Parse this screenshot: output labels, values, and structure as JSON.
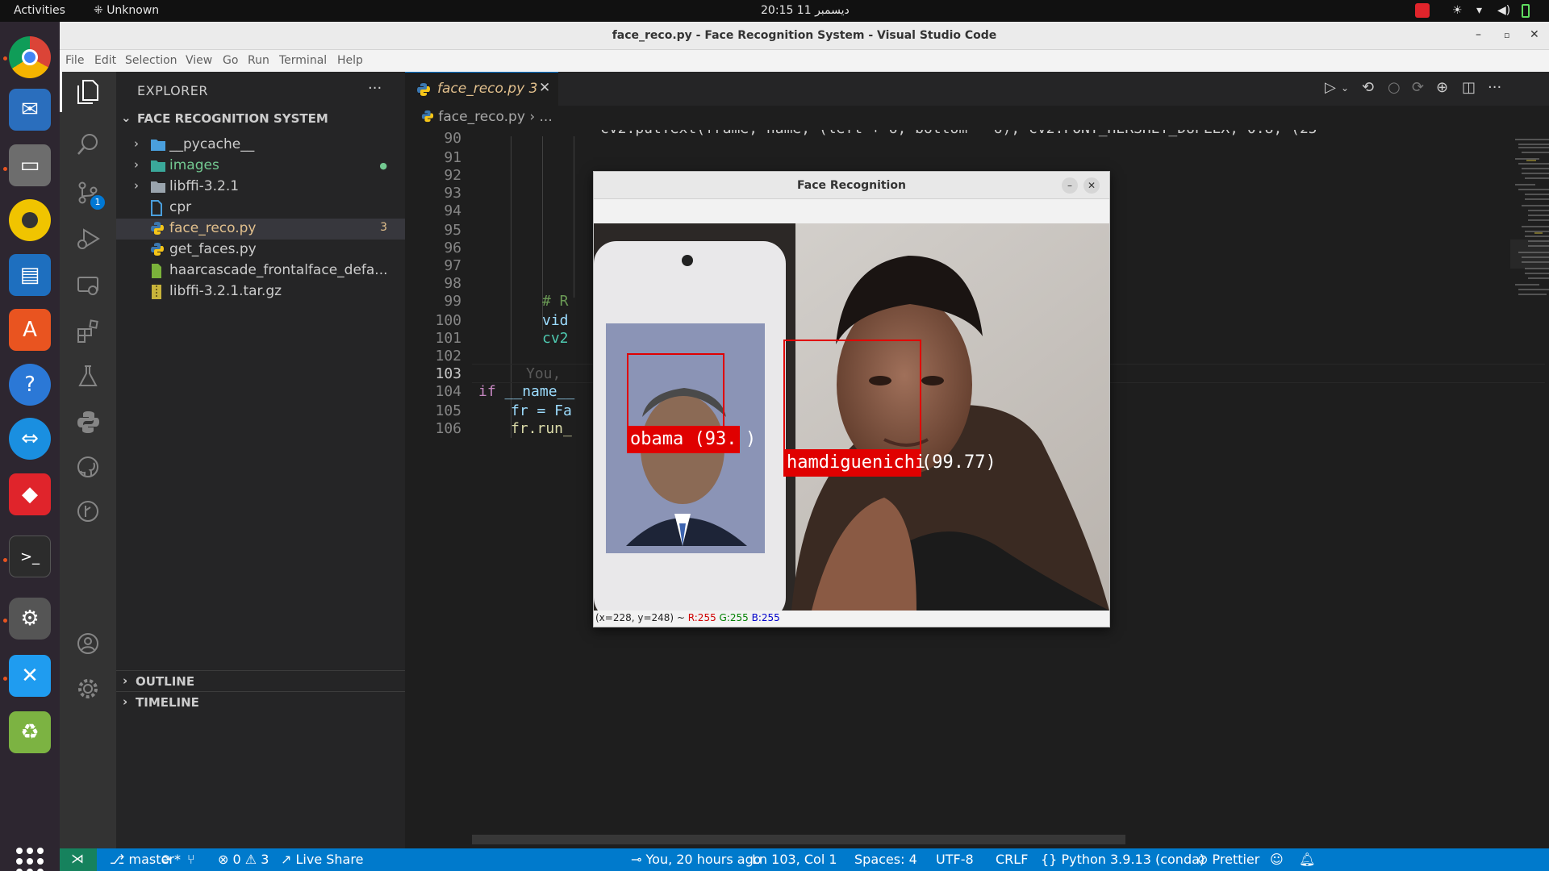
{
  "system": {
    "activities": "Activities",
    "app_menu": "Unknown",
    "clock": "20:15  11 ديسمبر"
  },
  "window": {
    "title": "face_reco.py - Face Recognition System - Visual Studio Code"
  },
  "menu": [
    "File",
    "Edit",
    "Selection",
    "View",
    "Go",
    "Run",
    "Terminal",
    "Help"
  ],
  "activity_bar": {
    "scm_badge": "1"
  },
  "explorer": {
    "header": "EXPLORER",
    "more": "···",
    "folder": "FACE RECOGNITION SYSTEM",
    "items": [
      {
        "name": "__pycache__",
        "status": ""
      },
      {
        "name": "images",
        "status": "●"
      },
      {
        "name": "libffi-3.2.1",
        "status": ""
      },
      {
        "name": "cpr",
        "status": ""
      },
      {
        "name": "face_reco.py",
        "status": "3"
      },
      {
        "name": "get_faces.py",
        "status": ""
      },
      {
        "name": "haarcascade_frontalface_defa...",
        "status": ""
      },
      {
        "name": "libffi-3.2.1.tar.gz",
        "status": ""
      }
    ],
    "outline": "OUTLINE",
    "timeline": "TIMELINE"
  },
  "editor": {
    "tab_label": "face_reco.py 3",
    "tab_close": "✕",
    "breadcrumb_file": "face_reco.py",
    "breadcrumb_rest": "› ...",
    "line_numbers": [
      "90",
      "91",
      "92",
      "93",
      "94",
      "95",
      "96",
      "97",
      "98",
      "99",
      "100",
      "101",
      "102",
      "103",
      "104",
      "105",
      "106"
    ],
    "top_line": "cv2.putText(frame, name, (left + 6, bottom - 6), cv2.FONT_HERSHEY_DUPLEX, 0.8, (25",
    "line99": "# R",
    "line100": "vid",
    "line101": "cv2",
    "blame": "You,",
    "line104_kw": "if",
    "line104_rest": " __name__",
    "line105": "fr = Fa",
    "line106": "fr.run_"
  },
  "opencv": {
    "title": "Face Recognition",
    "minimize": "–",
    "close": "✕",
    "faces": [
      {
        "name": "obama",
        "confidence": "(93.  )",
        "label": "obama (93."
      },
      {
        "name": "hamdiguenichi",
        "confidence": "(99.77)",
        "label": "hamdiguenichi"
      }
    ],
    "status_coords": "(x=228, y=248) ~ ",
    "status_r": "R:255",
    "status_g": "G:255",
    "status_b": "B:255"
  },
  "statusbar": {
    "branch": "master*",
    "problems": "⊗ 0 ⚠ 3",
    "live_share": "Live Share",
    "blame": "You, 20 hours ago",
    "position": "Ln 103, Col 1",
    "spaces": "Spaces: 4",
    "encoding": "UTF-8",
    "eol": "CRLF",
    "language": "Python",
    "interpreter": "3.9.13 (conda)",
    "prettier": "Prettier"
  },
  "colors": {
    "statusbar": "#007acc",
    "face_box": "#e00000",
    "tab_modified": "#e2c08d"
  }
}
